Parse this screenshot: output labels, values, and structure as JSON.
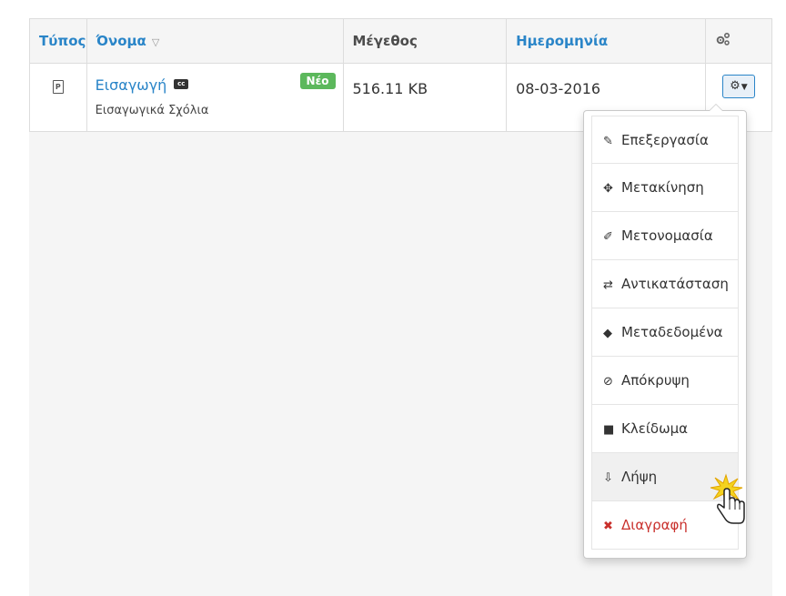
{
  "table": {
    "headers": {
      "type": "Τύπος",
      "name": "Όνομα",
      "size": "Μέγεθος",
      "date": "Ημερομηνία"
    },
    "rows": [
      {
        "type_icon": "pdf-file-icon",
        "type_glyph": "P",
        "name": "Εισαγωγή",
        "cc_label": "cc",
        "badge": "Νέο",
        "description": "Εισαγωγικά Σχόλια",
        "size": "516.11 KB",
        "date": "08-03-2016"
      }
    ]
  },
  "actions_menu": {
    "items": [
      {
        "label": "Επεξεργασία",
        "icon": "edit-icon",
        "glyph": "✎"
      },
      {
        "label": "Μετακίνηση",
        "icon": "move-icon",
        "glyph": "✥"
      },
      {
        "label": "Μετονομασία",
        "icon": "pencil-icon",
        "glyph": "✐"
      },
      {
        "label": "Αντικατάσταση",
        "icon": "swap-icon",
        "glyph": "⇄"
      },
      {
        "label": "Μεταδεδομένα",
        "icon": "tags-icon",
        "glyph": "◆"
      },
      {
        "label": "Απόκρυψη",
        "icon": "eye-slash-icon",
        "glyph": "⊘"
      },
      {
        "label": "Κλείδωμα",
        "icon": "lock-icon",
        "glyph": "■"
      },
      {
        "label": "Λήψη",
        "icon": "download-icon",
        "glyph": "⇩"
      },
      {
        "label": "Διαγραφή",
        "icon": "delete-icon",
        "glyph": "✖"
      }
    ]
  },
  "colors": {
    "link": "#2a85c8",
    "badge": "#5cb85c",
    "danger": "#c9302c",
    "header_bg": "#f5f5f5"
  }
}
